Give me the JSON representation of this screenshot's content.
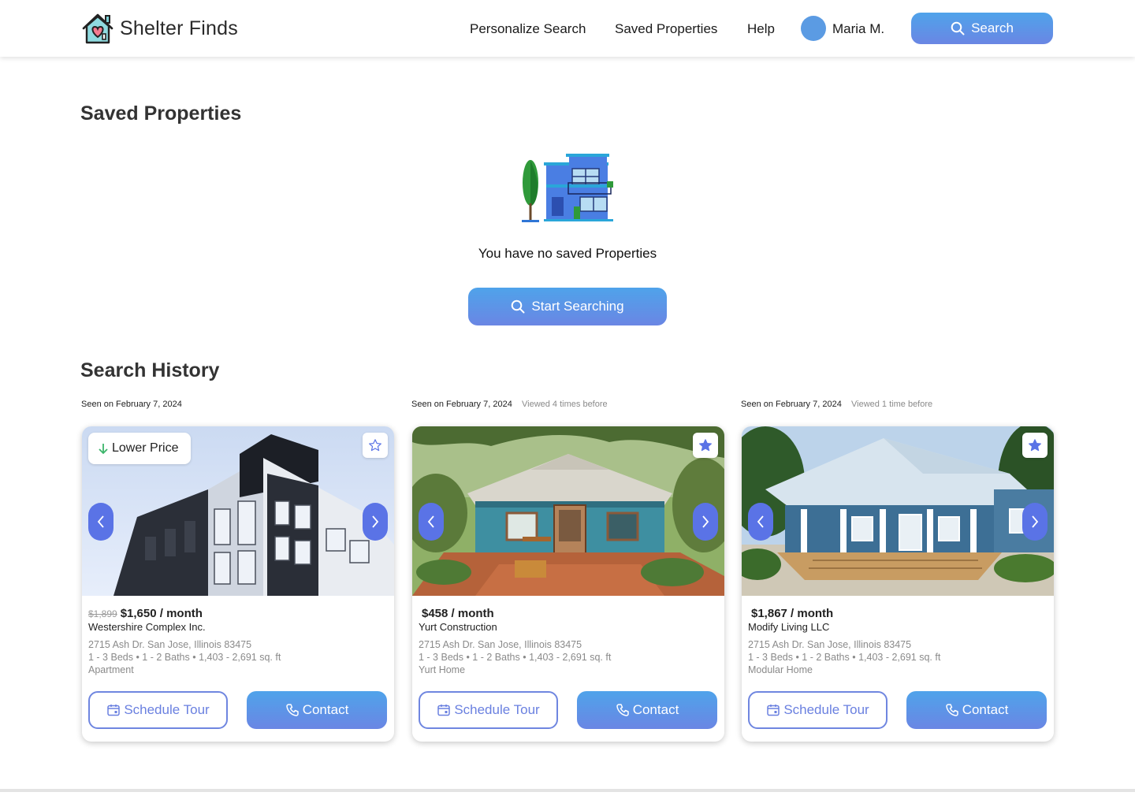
{
  "header": {
    "logo_text": "Shelter Finds",
    "nav": [
      "Personalize Search",
      "Saved Properties",
      "Help"
    ],
    "user_name": "Maria M.",
    "search_label": "Search"
  },
  "saved": {
    "title": "Saved Properties",
    "empty_text": "You have no saved Properties",
    "start_label": "Start Searching"
  },
  "history": {
    "title": "Search History",
    "cards": [
      {
        "seen": "Seen on February 7, 2024",
        "viewed": "",
        "badge": "Lower Price",
        "old_price": "$1,899",
        "price": "$1,650 / month",
        "company": "Westershire Complex Inc.",
        "address": "2715 Ash Dr. San Jose, Illinois 83475",
        "details": "1 - 3 Beds • 1 - 2 Baths • 1,403 - 2,691 sq. ft",
        "type": "Apartment",
        "favorited": false,
        "tour_label": "Schedule Tour",
        "contact_label": "Contact"
      },
      {
        "seen": "Seen on February 7, 2024",
        "viewed": "Viewed 4 times before",
        "badge": "",
        "old_price": "",
        "price": "$458 / month",
        "company": "Yurt Construction",
        "address": "2715 Ash Dr. San Jose, Illinois 83475",
        "details": "1 - 3 Beds • 1 - 2 Baths • 1,403 - 2,691 sq. ft",
        "type": "Yurt Home",
        "favorited": true,
        "tour_label": "Schedule Tour",
        "contact_label": "Contact"
      },
      {
        "seen": "Seen on February 7, 2024",
        "viewed": "Viewed 1 time before",
        "badge": "",
        "old_price": "",
        "price": "$1,867 / month",
        "company": "Modify Living LLC",
        "address": "2715 Ash Dr. San Jose, Illinois 83475",
        "details": "1 - 3 Beds • 1 - 2 Baths • 1,403 - 2,691 sq. ft",
        "type": "Modular Home",
        "favorited": true,
        "tour_label": "Schedule Tour",
        "contact_label": "Contact"
      }
    ]
  },
  "colors": {
    "accent_start": "#4fa3ea",
    "accent_end": "#6a86e4",
    "arrow_button": "#5a73e6",
    "badge_arrow": "#3bb56a"
  },
  "icons": [
    "house-heart-logo-icon",
    "search-icon",
    "star-outline-icon",
    "star-filled-icon",
    "chevron-left-icon",
    "chevron-right-icon",
    "calendar-icon",
    "phone-icon",
    "arrow-down-icon"
  ]
}
